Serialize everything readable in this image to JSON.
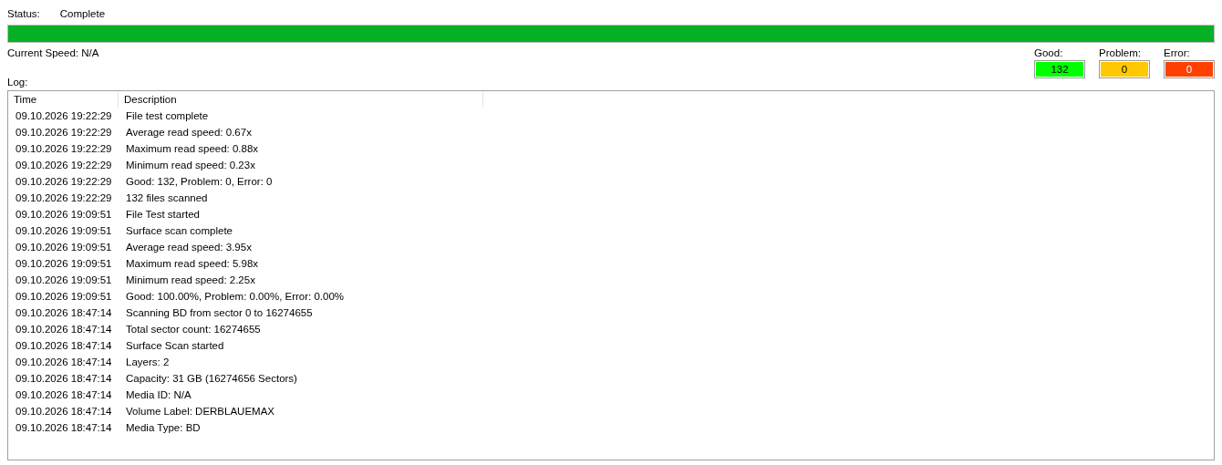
{
  "status": {
    "label": "Status:",
    "value": "Complete"
  },
  "progress": {
    "level": 1
  },
  "current_speed": "Current Speed: N/A",
  "counters": [
    {
      "label": "Good:",
      "value": "132",
      "color": "#00ff00"
    },
    {
      "label": "Problem:",
      "value": "0",
      "color": "#ffc800"
    },
    {
      "label": "Error:",
      "value": "0",
      "color": "#ff4000"
    }
  ],
  "log": {
    "label": "Log:",
    "columns": [
      "Time",
      "Description"
    ],
    "rows": [
      [
        "09.10.2026 19:22:29",
        "File test complete"
      ],
      [
        "09.10.2026 19:22:29",
        "Average read speed: 0.67x"
      ],
      [
        "09.10.2026 19:22:29",
        "Maximum read speed: 0.88x"
      ],
      [
        "09.10.2026 19:22:29",
        "Minimum read speed: 0.23x"
      ],
      [
        "09.10.2026 19:22:29",
        "Good: 132, Problem: 0, Error: 0"
      ],
      [
        "09.10.2026 19:22:29",
        "132 files scanned"
      ],
      [
        "09.10.2026 19:09:51",
        "File Test started"
      ],
      [
        "09.10.2026 19:09:51",
        "Surface scan complete"
      ],
      [
        "09.10.2026 19:09:51",
        "Average read speed: 3.95x"
      ],
      [
        "09.10.2026 19:09:51",
        "Maximum read speed: 5.98x"
      ],
      [
        "09.10.2026 19:09:51",
        "Minimum read speed: 2.25x"
      ],
      [
        "09.10.2026 19:09:51",
        "Good: 100.00%, Problem: 0.00%, Error: 0.00%"
      ],
      [
        "09.10.2026 18:47:14",
        "Scanning BD from sector 0 to 16274655"
      ],
      [
        "09.10.2026 18:47:14",
        "Total sector count: 16274655"
      ],
      [
        "09.10.2026 18:47:14",
        "Surface Scan started"
      ],
      [
        "09.10.2026 18:47:14",
        "Layers: 2"
      ],
      [
        "09.10.2026 18:47:14",
        "Capacity: 31 GB (16274656 Sectors)"
      ],
      [
        "09.10.2026 18:47:14",
        "Media ID: N/A"
      ],
      [
        "09.10.2026 18:47:14",
        "Volume Label: DERBLAUEMAX"
      ],
      [
        "09.10.2026 18:47:14",
        "Media Type: BD"
      ]
    ]
  }
}
